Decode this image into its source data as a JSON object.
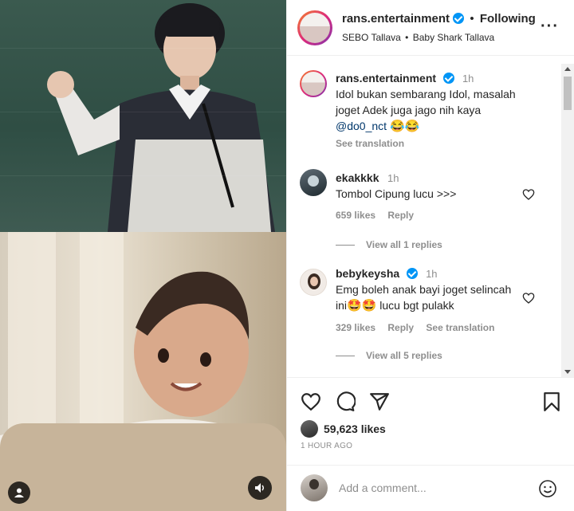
{
  "post": {
    "username": "rans.entertainment",
    "follow_status": "Following",
    "audio_artist": "SEBO Tallava",
    "audio_title": "Baby Shark Tallava",
    "separator": "•",
    "more_icon": "more-horizontal-icon"
  },
  "caption": {
    "username": "rans.entertainment",
    "time": "1h",
    "text": "Idol bukan sembarang Idol, masalah joget Adek juga jago nih kaya",
    "mention": "@do0_nct",
    "emoji": "😂😂",
    "see_translation": "See translation"
  },
  "comments": [
    {
      "username": "ekakkkk",
      "time": "1h",
      "text": "Tombol Cipung lucu >>>",
      "likes": "659 likes",
      "reply": "Reply",
      "view_replies": "View all 1 replies"
    },
    {
      "username": "bebykeysha",
      "time": "1h",
      "text_a": "Emg boleh anak bayi joget selincah",
      "text_b_pre": "ini",
      "text_b_emoji": "🤩🤩",
      "text_b_post": "lucu bgt pulakk",
      "likes": "329 likes",
      "reply": "Reply",
      "see_translation": "See translation",
      "view_replies": "View all 5 replies"
    }
  ],
  "stats": {
    "likes": "59,623 likes",
    "time_ago": "1 HOUR AGO"
  },
  "add_comment": {
    "placeholder": "Add a comment..."
  },
  "colors": {
    "verified": "#0095f6",
    "secondary_text": "#8e8e8e",
    "mention": "#00376b"
  }
}
